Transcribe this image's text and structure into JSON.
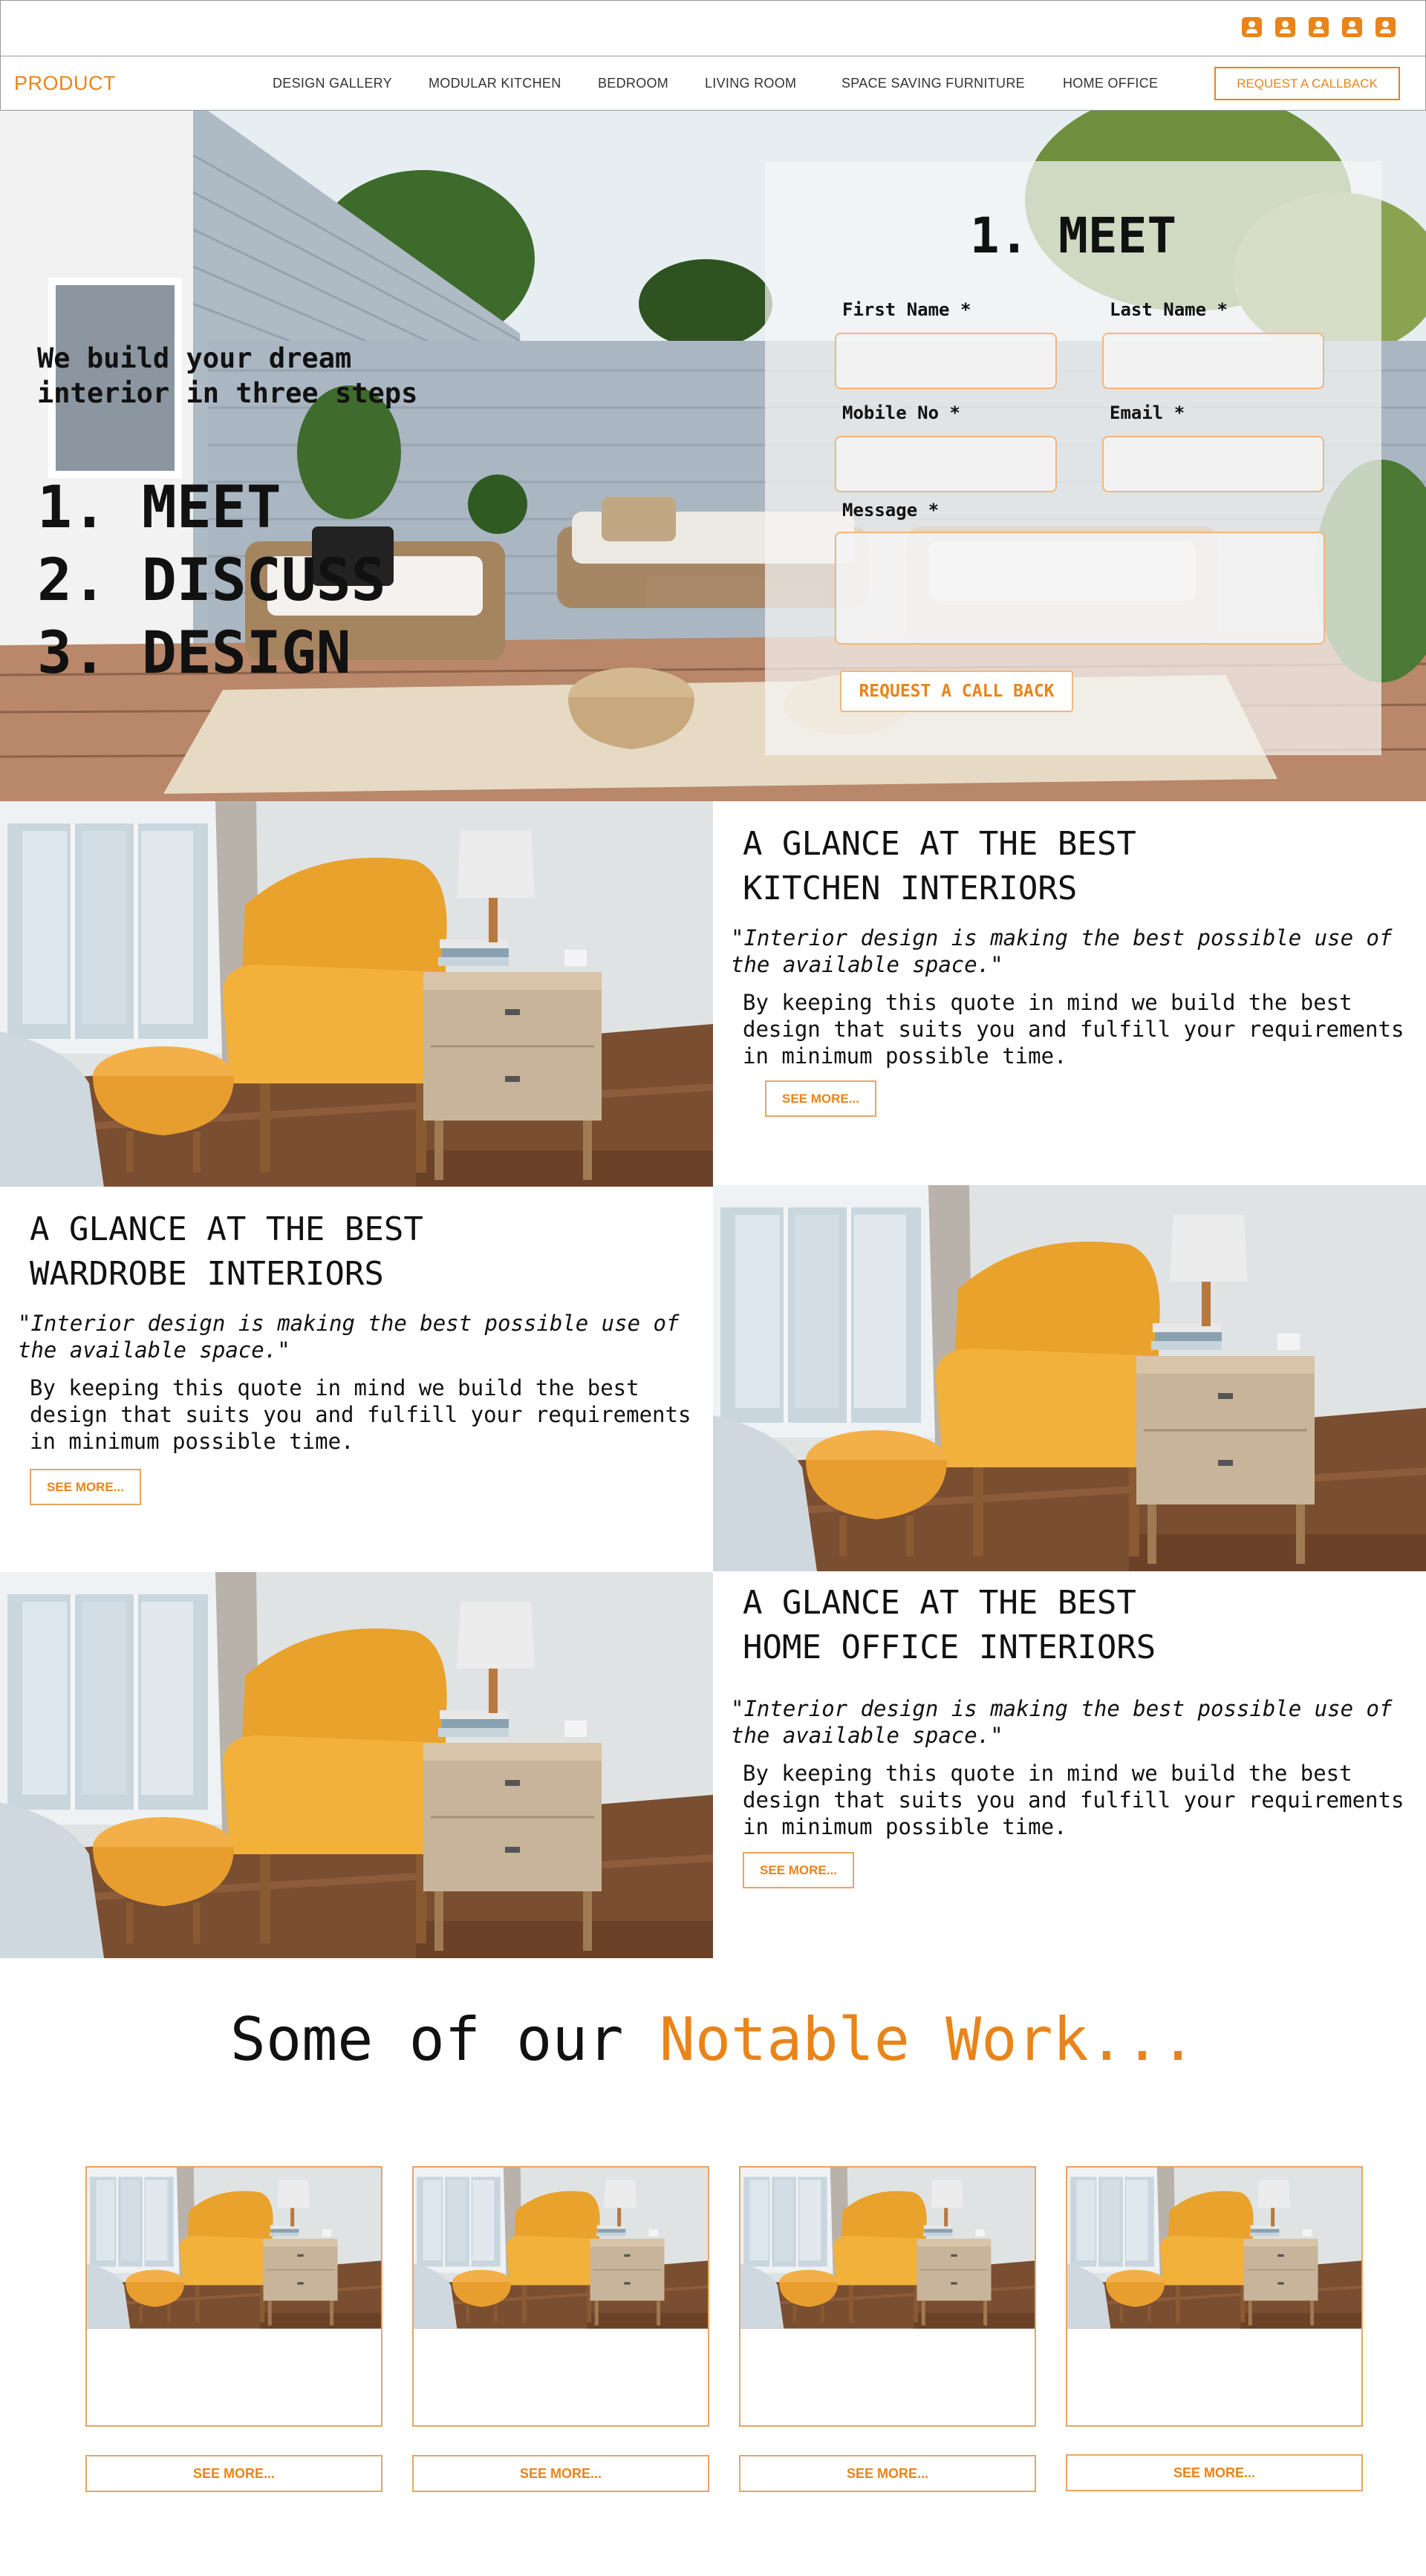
{
  "colors": {
    "accent": "#e8841a"
  },
  "header": {
    "icons": [
      "user-icon",
      "user-icon",
      "user-icon",
      "user-icon",
      "user-icon"
    ]
  },
  "nav": {
    "brand": "PRODUCT",
    "links": [
      "DESIGN GALLERY",
      "MODULAR KITCHEN",
      "BEDROOM",
      "LIVING ROOM",
      "SPACE SAVING FURNITURE",
      "HOME OFFICE"
    ],
    "cta": "REQUEST A CALLBACK"
  },
  "hero": {
    "subtitle": "We build your dream interior in three steps",
    "steps": [
      "1. MEET",
      "2. DISCUSS",
      "3. DESIGN"
    ]
  },
  "form": {
    "title": "1. MEET",
    "first_name_label": "First Name *",
    "last_name_label": "Last Name *",
    "mobile_label": "Mobile No *",
    "email_label": "Email *",
    "message_label": "Message *",
    "submit": "REQUEST A CALL BACK"
  },
  "features": [
    {
      "title_line1": "A GLANCE AT THE BEST",
      "title_line2": "KITCHEN INTERIORS",
      "quote": "\"Interior design is making the best possible use of the available space.\"",
      "body": "By keeping this quote in mind we build the best design that suits you and fulfill your requirements in minimum possible time.",
      "button": "SEE MORE..."
    },
    {
      "title_line1": "A GLANCE AT THE BEST",
      "title_line2": "WARDROBE INTERIORS",
      "quote": "\"Interior design is making the best possible use of the available space.\"",
      "body": "By keeping this quote in mind we build the best design that suits you and fulfill your requirements in minimum possible time.",
      "button": "SEE MORE..."
    },
    {
      "title_line1": "A GLANCE AT THE BEST",
      "title_line2": "HOME OFFICE INTERIORS",
      "quote": "\"Interior design is making the best possible use of the available space.\"",
      "body": "By keeping this quote in mind we build the best design that suits you and fulfill your requirements in minimum possible time.",
      "button": "SEE MORE..."
    }
  ],
  "notable": {
    "prefix": "Some of our ",
    "highlight": "Notable Work...",
    "cards": [
      {
        "button": "SEE MORE..."
      },
      {
        "button": "SEE MORE..."
      },
      {
        "button": "SEE MORE..."
      },
      {
        "button": "SEE MORE..."
      }
    ]
  }
}
